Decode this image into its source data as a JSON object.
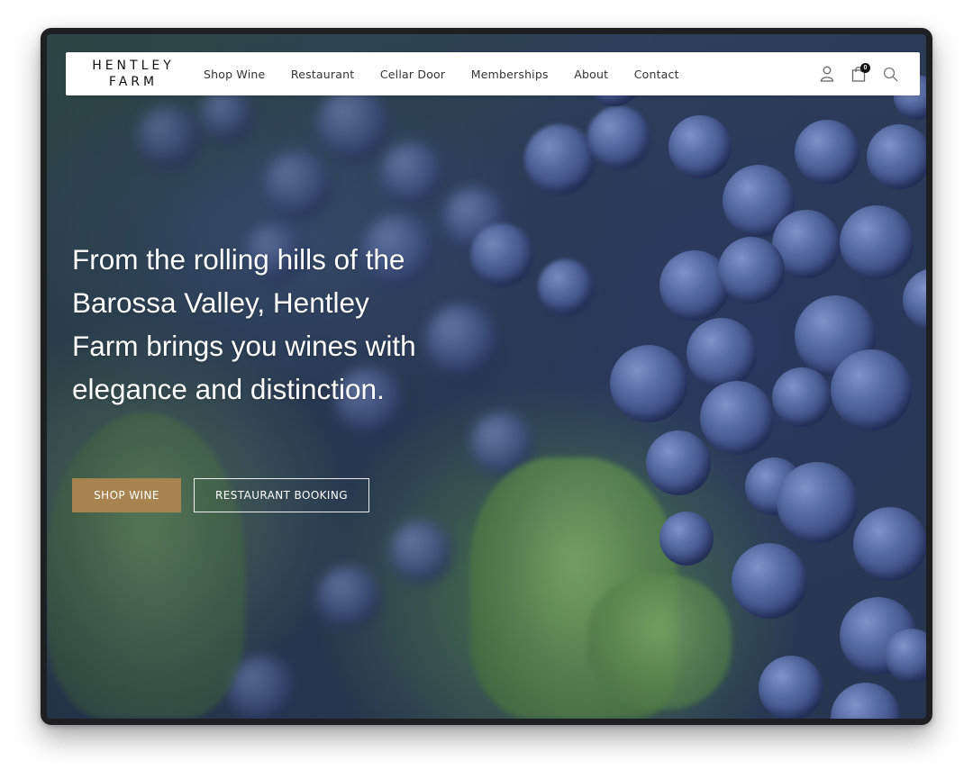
{
  "brand": {
    "line1": "HENTLEY",
    "line2": "FARM"
  },
  "nav": {
    "items": [
      {
        "label": "Shop Wine"
      },
      {
        "label": "Restaurant"
      },
      {
        "label": "Cellar Door"
      },
      {
        "label": "Memberships"
      },
      {
        "label": "About"
      },
      {
        "label": "Contact"
      }
    ],
    "icons": {
      "account": "user-icon",
      "cart": "shopping-bag-icon",
      "search": "search-icon"
    },
    "cart_count": "0"
  },
  "hero": {
    "headline": "From the rolling hills of the Barossa Valley, Hentley Farm brings you wines with elegance and distinction.",
    "primary_button": "SHOP WINE",
    "secondary_button": "RESTAURANT BOOKING",
    "background": "grape-vine-photo"
  },
  "colors": {
    "accent": "#a7834f",
    "nav_background": "#ffffff",
    "headline": "#ffffff"
  }
}
